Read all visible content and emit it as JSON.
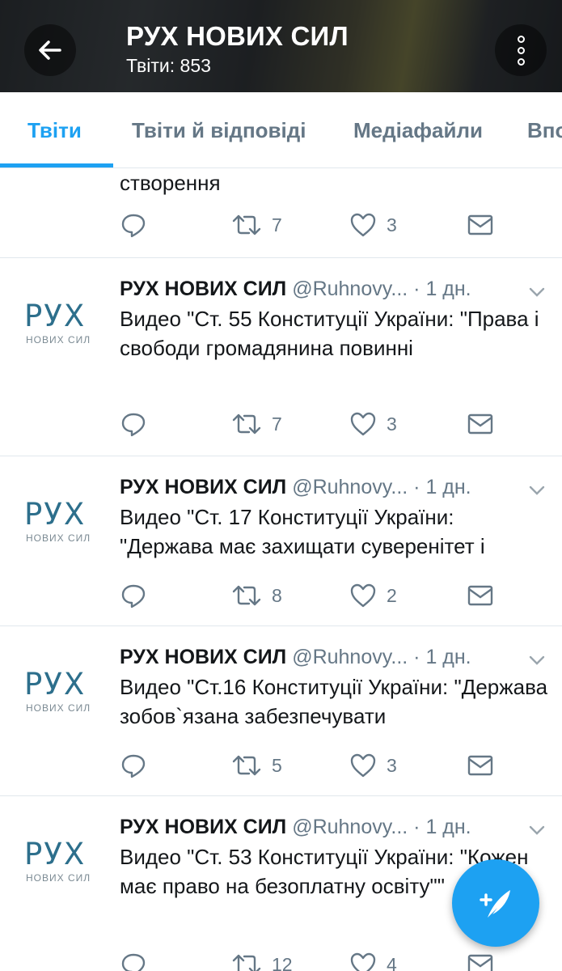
{
  "header": {
    "title": "РУХ НОВИХ СИЛ",
    "subtitle": "Твіти: 853"
  },
  "tabs": [
    {
      "label": "Твіти",
      "active": true
    },
    {
      "label": "Твіти й відповіді",
      "active": false
    },
    {
      "label": "Медіафайли",
      "active": false
    },
    {
      "label": "Впо",
      "active": false
    }
  ],
  "logo": {
    "main": "РУХ",
    "sub": "НОВИХ СИЛ"
  },
  "partial_tweet": {
    "text": "створення",
    "replies": "",
    "retweets": "7",
    "likes": "3"
  },
  "tweets": [
    {
      "name": "РУХ НОВИХ СИЛ",
      "handle": "@Ruhnovy...",
      "time": "· 1 дн.",
      "text": "Видео \"Ст. 55 Конституції України: \"Права і свободи громадянина повинні",
      "retweets": "7",
      "likes": "3"
    },
    {
      "name": "РУХ НОВИХ СИЛ",
      "handle": "@Ruhnovy...",
      "time": "· 1 дн.",
      "text": "Видео \"Ст. 17 Конституції України: \"Держава має захищати суверенітет і",
      "retweets": "8",
      "likes": "2"
    },
    {
      "name": "РУХ НОВИХ СИЛ",
      "handle": "@Ruhnovy...",
      "time": "· 1 дн.",
      "text": "Видео \"Ст.16 Конституції України: \"Держава зобов`язана забезпечувати",
      "retweets": "5",
      "likes": "3"
    },
    {
      "name": "РУХ НОВИХ СИЛ",
      "handle": "@Ruhnovy...",
      "time": "· 1 дн.",
      "text": "Видео \"Ст. 53 Конституції України: \"Кожен має право на безоплатну освіту\"\"",
      "retweets": "12",
      "likes": "4"
    }
  ],
  "colors": {
    "accent": "#1da1f2",
    "secondary_text": "#657786",
    "logo": "#2d6f8c",
    "divider": "#e1e8ed"
  },
  "icons": [
    "back-arrow-icon",
    "more-vertical-icon",
    "reply-icon",
    "retweet-icon",
    "like-icon",
    "message-icon",
    "chevron-down-icon",
    "compose-tweet-icon"
  ]
}
